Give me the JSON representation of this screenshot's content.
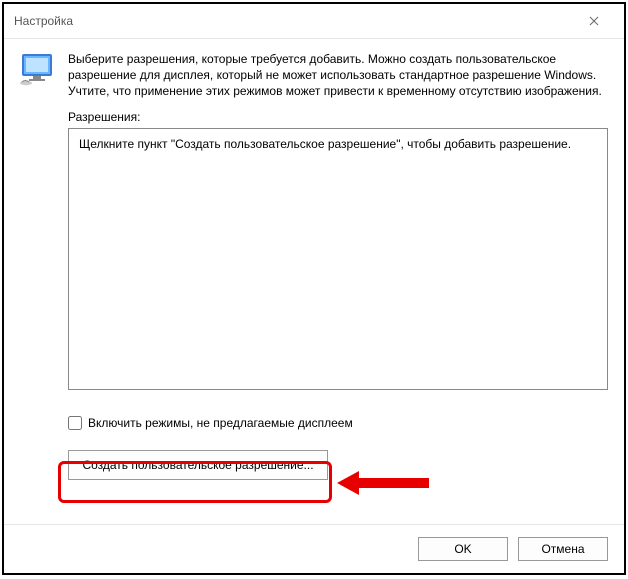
{
  "window": {
    "title": "Настройка"
  },
  "intro": {
    "text": "Выберите разрешения, которые требуется добавить. Можно создать пользовательское разрешение для дисплея, который не может использовать стандартное разрешение Windows. Учтите, что применение этих режимов может привести к временному отсутствию изображения."
  },
  "resolutions": {
    "label": "Разрешения:",
    "placeholder": "Щелкните пункт \"Создать пользовательское разрешение\", чтобы добавить разрешение."
  },
  "checkbox": {
    "label": "Включить режимы, не предлагаемые дисплеем"
  },
  "buttons": {
    "create": "Создать пользовательское разрешение...",
    "ok": "OK",
    "cancel": "Отмена"
  }
}
